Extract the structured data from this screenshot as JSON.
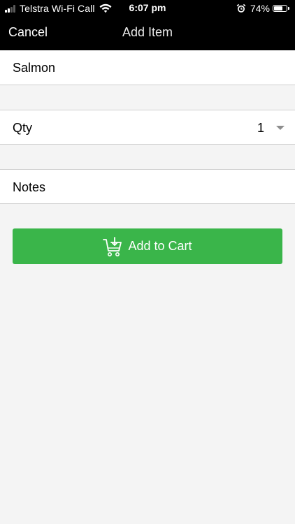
{
  "status_bar": {
    "carrier": "Telstra Wi-Fi Call",
    "time": "6:07 pm",
    "battery_percent_label": "74%",
    "battery_level": 0.74,
    "signal_bars_active": 2,
    "signal_bars_total": 4,
    "icons": [
      "signal-icon",
      "wifi-icon",
      "alarm-icon",
      "battery-icon"
    ]
  },
  "nav": {
    "cancel_label": "Cancel",
    "title": "Add Item"
  },
  "form": {
    "item_name": "Salmon",
    "qty_label": "Qty",
    "qty_value": "1",
    "notes_label": "Notes"
  },
  "add_button": {
    "label": "Add to Cart",
    "icon": "cart-icon"
  },
  "colors": {
    "nav_background": "#000000",
    "page_background": "#f4f4f4",
    "button_green": "#3ab54a",
    "divider": "#cfcfcf"
  }
}
